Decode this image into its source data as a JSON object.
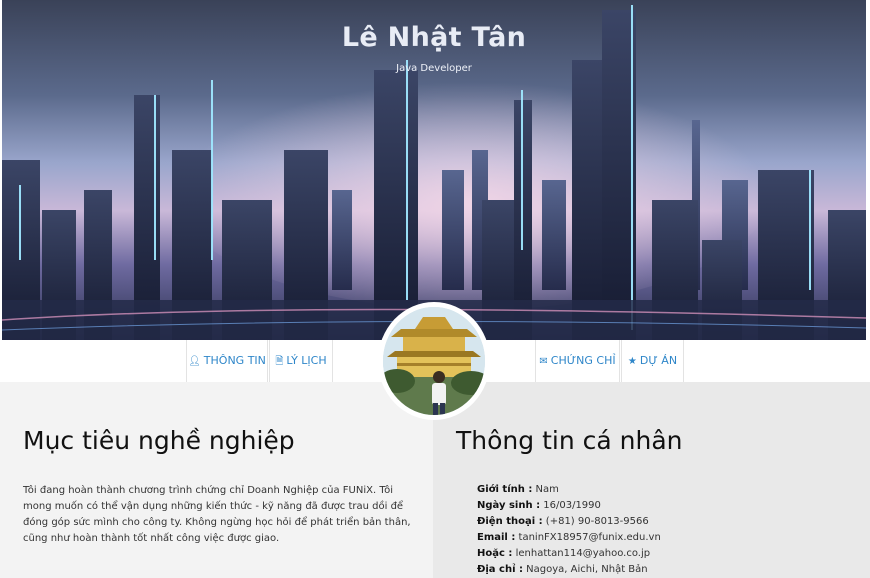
{
  "hero": {
    "name": "Lê Nhật Tân",
    "title": "Java Developer"
  },
  "nav": {
    "info": "THÔNG TIN",
    "cv": "LÝ LỊCH",
    "certificates": "CHỨNG CHỈ",
    "projects": "DỰ ÁN"
  },
  "icons": {
    "info": "user-icon",
    "cv": "file-icon",
    "certificates": "envelope-icon",
    "projects": "star-icon"
  },
  "colors": {
    "nav_link": "#2e86c9",
    "left_bg": "#f3f3f3",
    "right_bg": "#e9e9e9"
  },
  "objective": {
    "heading": "Mục tiêu nghề nghiệp",
    "text": "Tôi đang hoàn thành chương trình chứng chỉ Doanh Nghiệp của FUNiX. Tôi mong muốn có thể vận dụng những kiến thức - kỹ năng đã được trau dồi để đóng góp sức mình cho công ty. Không ngừng học hỏi để phát triển bản thân, cũng như hoàn thành tốt nhất công việc được giao."
  },
  "personal": {
    "heading": "Thông tin cá nhân",
    "items": [
      {
        "label": "Giới tính :",
        "value": " Nam"
      },
      {
        "label": "Ngày sinh :",
        "value": " 16/03/1990"
      },
      {
        "label": "Điện thoại :",
        "value": " (+81) 90-8013-9566"
      },
      {
        "label": "Email :",
        "value": " taninFX18957@funix.edu.vn"
      },
      {
        "label": "Hoặc :",
        "value": " lenhattan114@yahoo.co.jp"
      },
      {
        "label": "Địa chỉ :",
        "value": " Nagoya, Aichi, Nhật Bản"
      }
    ]
  }
}
